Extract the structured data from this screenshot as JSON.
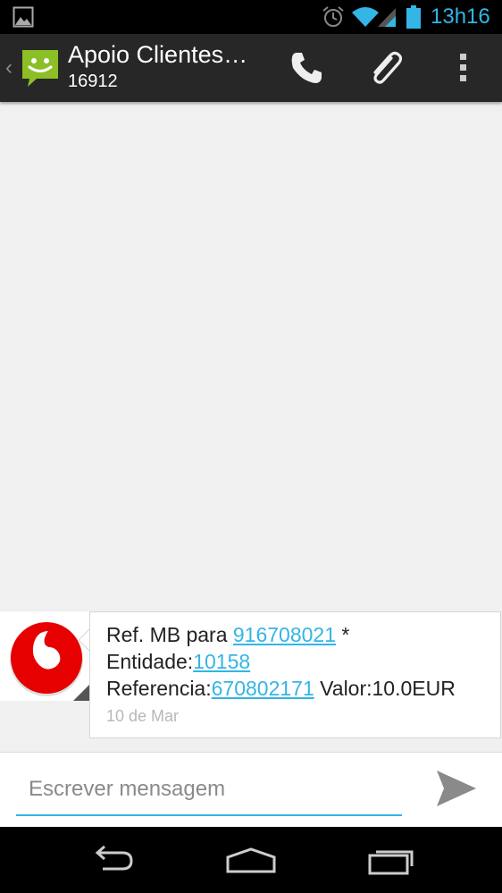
{
  "colors": {
    "accent": "#33b5e5",
    "app_icon": "#8cbf26",
    "vodafone_red": "#e60000",
    "statusbar_bg": "#000000",
    "actionbar_bg": "#272727",
    "background": "#f0f0f0"
  },
  "statusbar": {
    "time": "13h16",
    "icons": [
      "gallery-icon",
      "alarm-icon",
      "wifi-icon",
      "signal-icon",
      "battery-icon"
    ]
  },
  "actionbar": {
    "back_icon": "chevron-left-icon",
    "app_icon": "messaging-icon",
    "title": "Apoio Clientes…",
    "subtitle": "16912",
    "actions": [
      "phone-icon",
      "paperclip-icon",
      "overflow-menu-icon"
    ]
  },
  "message": {
    "avatar_icon": "vodafone-logo-icon",
    "line1_prefix": "Ref. MB para ",
    "line1_link": "916708021",
    "line1_suffix": " *",
    "line2_prefix": "Entidade:",
    "line2_link": "10158",
    "line3_prefix": "Referencia:",
    "line3_link": "670802171",
    "line3_suffix": " Valor:10.0EUR",
    "date": "10 de Mar"
  },
  "composer": {
    "placeholder": "Escrever mensagem",
    "value": "",
    "send_icon": "send-icon"
  },
  "navbar": {
    "buttons": [
      "back-nav-icon",
      "home-nav-icon",
      "recent-apps-icon"
    ]
  }
}
